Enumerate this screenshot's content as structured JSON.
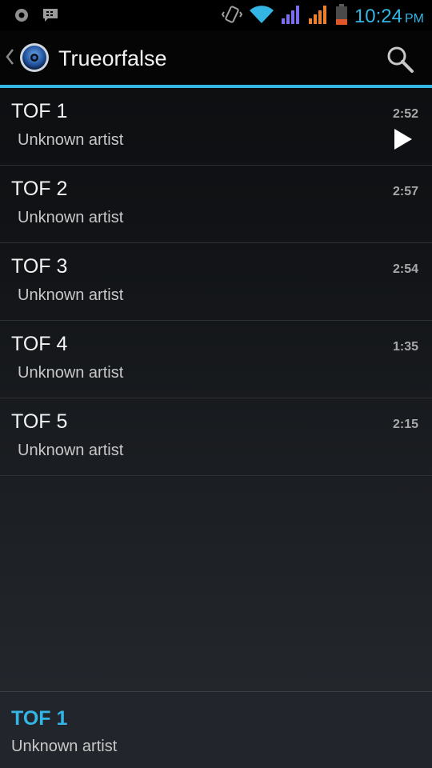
{
  "status_bar": {
    "time": "10:24",
    "ampm": "PM",
    "icons": [
      "settings-notification-icon",
      "bbm-icon",
      "vibrate-icon",
      "wifi-icon",
      "signal-1-icon",
      "signal-2-icon",
      "battery-icon"
    ],
    "colors": {
      "accent": "#33b5e5",
      "signal1": "#7b6ff0",
      "signal2": "#ee7f2d",
      "battery": "#e0562b"
    }
  },
  "action_bar": {
    "title": "Trueorfalse",
    "icons": [
      "up-caret-icon",
      "speaker-icon",
      "search-icon"
    ]
  },
  "tracks": [
    {
      "title": "TOF 1",
      "artist": "Unknown artist",
      "duration": "2:52",
      "playing": true
    },
    {
      "title": "TOF 2",
      "artist": "Unknown artist",
      "duration": "2:57",
      "playing": false
    },
    {
      "title": "TOF 3",
      "artist": "Unknown artist",
      "duration": "2:54",
      "playing": false
    },
    {
      "title": "TOF 4",
      "artist": "Unknown artist",
      "duration": "1:35",
      "playing": false
    },
    {
      "title": "TOF 5",
      "artist": "Unknown artist",
      "duration": "2:15",
      "playing": false
    }
  ],
  "now_playing": {
    "title": "TOF 1",
    "artist": "Unknown artist"
  }
}
